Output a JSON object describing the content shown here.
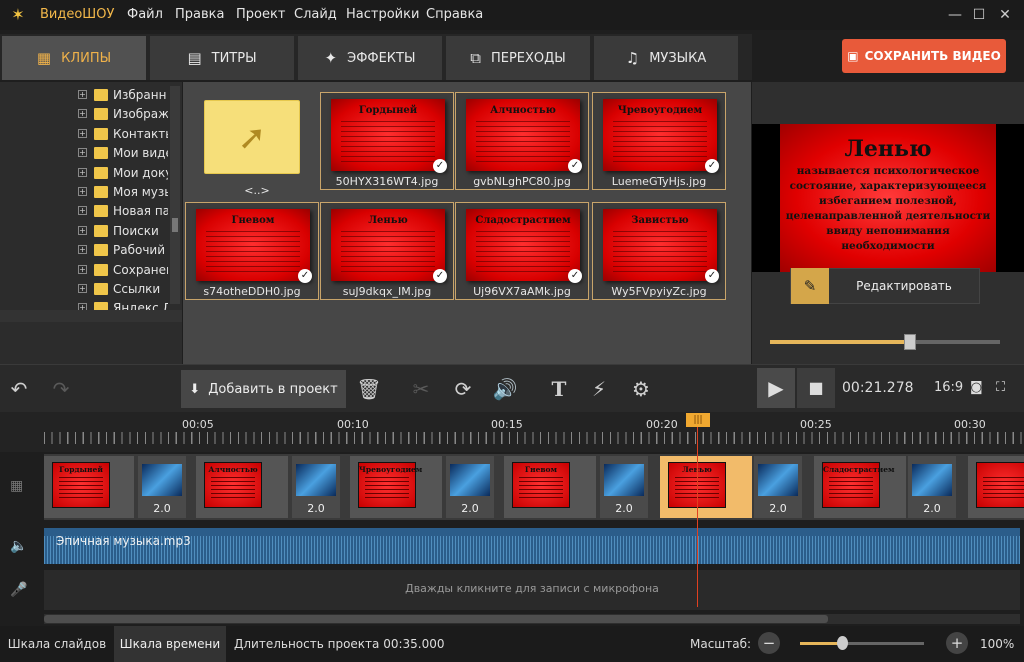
{
  "app": {
    "title": "ВидеоШОУ",
    "menu": [
      "Файл",
      "Правка",
      "Проект",
      "Слайд",
      "Настройки",
      "Справка"
    ]
  },
  "tabs": [
    {
      "label": "КЛИПЫ",
      "icon": "film-icon"
    },
    {
      "label": "ТИТРЫ",
      "icon": "titles-icon"
    },
    {
      "label": "ЭФФЕКТЫ",
      "icon": "effects-icon"
    },
    {
      "label": "ПЕРЕХОДЫ",
      "icon": "transitions-icon"
    },
    {
      "label": "МУЗЫКА",
      "icon": "music-icon"
    }
  ],
  "save_button": "СОХРАНИТЬ ВИДЕО",
  "tree": [
    "Избранн",
    "Изображ",
    "Контакты",
    "Мои виде",
    "Мои доку",
    "Моя музы",
    "Новая па",
    "Поиски",
    "Рабочий",
    "Сохранен",
    "Ссылки",
    "Яндекс.Д"
  ],
  "clips": {
    "up_label": "<..>",
    "items": [
      {
        "title": "Гордыней",
        "file": "50HYX316WT4.jpg"
      },
      {
        "title": "Алчностью",
        "file": "gvbNLghPC80.jpg"
      },
      {
        "title": "Чревоугодием",
        "file": "LuemeGTyHjs.jpg"
      },
      {
        "title": "Гневом",
        "file": "s74otheDDH0.jpg"
      },
      {
        "title": "Ленью",
        "file": "suJ9dkqx_IM.jpg"
      },
      {
        "title": "Сладострастием",
        "file": "Uj96VX7aAMk.jpg"
      },
      {
        "title": "Завистью",
        "file": "Wy5FVpyiyZc.jpg"
      }
    ]
  },
  "preview": {
    "title": "Ленью",
    "body": "называется психологическое состояние, характеризующееся избеганием полезной, целенаправленной деятельности ввиду непонимания необходимости",
    "edit_label": "Редактировать",
    "volume": 0.61
  },
  "toolbar": {
    "add_label": "Добавить в проект",
    "time": "00:21.278",
    "aspect": "16:9"
  },
  "timeline": {
    "ticks": [
      "00:05",
      "00:10",
      "00:15",
      "00:20",
      "00:25",
      "00:30"
    ],
    "slides": [
      "Гордыней",
      "Алчностью",
      "Чревоугодием",
      "Гневом",
      "Ленью",
      "Сладострастием",
      ""
    ],
    "transition_duration": "2.0",
    "audio_label": "Эпичная музыка.mp3",
    "mic_hint": "Дважды кликните для записи с микрофона"
  },
  "status": {
    "mode_slides": "Шкала слайдов",
    "mode_timeline": "Шкала времени",
    "duration": "Длительность проекта 00:35.000",
    "zoom_label": "Масштаб:",
    "zoom_value": "100%"
  },
  "colors": {
    "accent": "#f0b24a",
    "save": "#e85a3a",
    "slide": "#e00000",
    "audio": "#2b5d8a"
  }
}
